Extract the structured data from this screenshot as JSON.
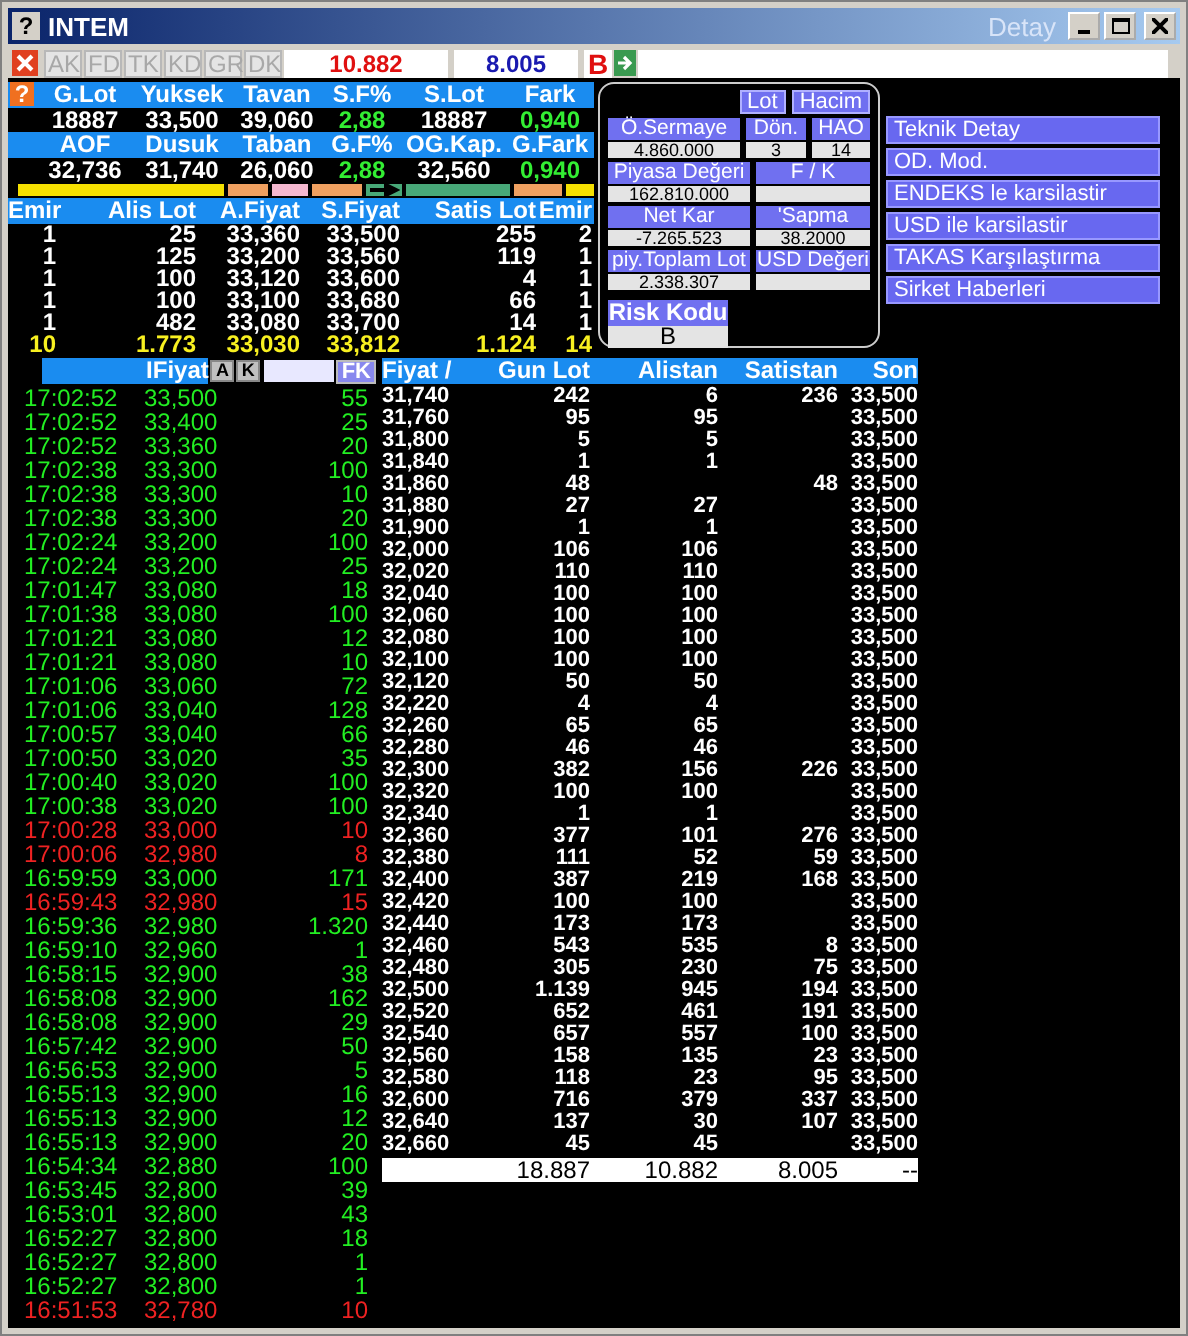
{
  "window": {
    "title": "INTEM",
    "help_icon": "?",
    "subtitle": "Detay"
  },
  "toolbar": {
    "tabs": [
      {
        "label": "AK",
        "disabled": true
      },
      {
        "label": "FD",
        "disabled": true
      },
      {
        "label": "TK",
        "disabled": true
      },
      {
        "label": "KD",
        "disabled": true
      },
      {
        "label": "GR",
        "disabled": true
      },
      {
        "label": "DK",
        "disabled": true
      }
    ],
    "buy_total": "10.882",
    "sell_total": "8.005",
    "side": "B"
  },
  "stats": {
    "help_icon": "?",
    "rows": [
      [
        {
          "label": "G.Lot",
          "value": "18887",
          "kind": "plain"
        },
        {
          "label": "Yuksek",
          "value": "33,500",
          "kind": "plain"
        },
        {
          "label": "Tavan",
          "value": "39,060",
          "kind": "plain"
        },
        {
          "label": "S.F%",
          "value": "2,88",
          "kind": "change"
        },
        {
          "label": "S.Lot",
          "value": "18887",
          "kind": "plain"
        },
        {
          "label": "Fark",
          "value": "0,940",
          "kind": "change"
        }
      ],
      [
        {
          "label": "AOF",
          "value": "32,736",
          "kind": "plain"
        },
        {
          "label": "Dusuk",
          "value": "31,740",
          "kind": "plain"
        },
        {
          "label": "Taban",
          "value": "26,060",
          "kind": "plain"
        },
        {
          "label": "G.F%",
          "value": "2,88",
          "kind": "change"
        },
        {
          "label": "OG.Kap.",
          "value": "32,560",
          "kind": "plain"
        },
        {
          "label": "G.Fark",
          "value": "0,940",
          "kind": "change"
        }
      ]
    ]
  },
  "bar": [
    {
      "kind": "segment",
      "color": "#f5e000"
    },
    {
      "kind": "segment",
      "color": "#f0a060"
    },
    {
      "kind": "segment",
      "color": "#f4b8d0"
    },
    {
      "kind": "segment",
      "color": "#f0a060"
    },
    {
      "kind": "arrow",
      "color": "#48a878"
    },
    {
      "kind": "segment",
      "color": "#48a878"
    },
    {
      "kind": "segment",
      "color": "#f0a060"
    },
    {
      "kind": "segment",
      "color": "#f5e000"
    }
  ],
  "orderbook": {
    "columns": [
      "Emir",
      "Alis Lot",
      "A.Fiyat",
      "S.Fiyat",
      "Satis Lot",
      "Emir"
    ],
    "rows": [
      {
        "kind": "level",
        "cells": [
          "1",
          "25",
          "33,360",
          "33,500",
          "255",
          "2"
        ]
      },
      {
        "kind": "level",
        "cells": [
          "1",
          "125",
          "33,200",
          "33,560",
          "119",
          "1"
        ]
      },
      {
        "kind": "level",
        "cells": [
          "1",
          "100",
          "33,120",
          "33,600",
          "4",
          "1"
        ]
      },
      {
        "kind": "level",
        "cells": [
          "1",
          "100",
          "33,100",
          "33,680",
          "66",
          "1"
        ]
      },
      {
        "kind": "level",
        "cells": [
          "1",
          "482",
          "33,080",
          "33,700",
          "14",
          "1"
        ]
      },
      {
        "kind": "total",
        "cells": [
          "10",
          "1.773",
          "33,030",
          "33,812",
          "1.124",
          "14"
        ]
      }
    ]
  },
  "panel": {
    "buttons": [
      "Lot",
      "Hacim"
    ],
    "rows": [
      [
        {
          "label": "Ö.Sermaye",
          "value": "4.860.000"
        },
        {
          "label": "Dön.",
          "value": "3"
        },
        {
          "label": "HAO",
          "value": "14"
        }
      ],
      [
        {
          "label": "Piyasa Değeri",
          "value": "162.810.000"
        },
        {
          "label": "F / K"
        }
      ],
      [
        {
          "label": "Net Kar",
          "value": "-7.265.523"
        },
        {
          "label": "'Sapma",
          "value": "38.2000"
        }
      ],
      [
        {
          "label": "piy.Toplam Lot",
          "value": "2.338.307"
        },
        {
          "label": "USD Değeri"
        }
      ]
    ],
    "risk": {
      "label": "Risk Kodu",
      "value": "B"
    }
  },
  "menu": [
    "Teknik Detay",
    "OD. Mod.",
    "ENDEKS le karsilastir",
    "USD ile karsilastir",
    "TAKAS Karşılaştırma",
    "Sirket Haberleri"
  ],
  "trades": {
    "header": "IFiyat",
    "buttons": [
      "A",
      "K"
    ],
    "filter_button": "FK",
    "rows": [
      {
        "time": "17:02:52",
        "price": "33,500",
        "lot": "55",
        "color": "#22ee22"
      },
      {
        "time": "17:02:52",
        "price": "33,400",
        "lot": "25",
        "color": "#22ee22"
      },
      {
        "time": "17:02:52",
        "price": "33,360",
        "lot": "20",
        "color": "#22ee22"
      },
      {
        "time": "17:02:38",
        "price": "33,300",
        "lot": "100",
        "color": "#22ee22"
      },
      {
        "time": "17:02:38",
        "price": "33,300",
        "lot": "10",
        "color": "#22ee22"
      },
      {
        "time": "17:02:38",
        "price": "33,300",
        "lot": "20",
        "color": "#22ee22"
      },
      {
        "time": "17:02:24",
        "price": "33,200",
        "lot": "100",
        "color": "#22ee22"
      },
      {
        "time": "17:02:24",
        "price": "33,200",
        "lot": "25",
        "color": "#22ee22"
      },
      {
        "time": "17:01:47",
        "price": "33,080",
        "lot": "18",
        "color": "#22ee22"
      },
      {
        "time": "17:01:38",
        "price": "33,080",
        "lot": "100",
        "color": "#22ee22"
      },
      {
        "time": "17:01:21",
        "price": "33,080",
        "lot": "12",
        "color": "#22ee22"
      },
      {
        "time": "17:01:21",
        "price": "33,080",
        "lot": "10",
        "color": "#22ee22"
      },
      {
        "time": "17:01:06",
        "price": "33,060",
        "lot": "72",
        "color": "#22ee22"
      },
      {
        "time": "17:01:06",
        "price": "33,040",
        "lot": "128",
        "color": "#22ee22"
      },
      {
        "time": "17:00:57",
        "price": "33,040",
        "lot": "66",
        "color": "#22ee22"
      },
      {
        "time": "17:00:50",
        "price": "33,020",
        "lot": "35",
        "color": "#22ee22"
      },
      {
        "time": "17:00:40",
        "price": "33,020",
        "lot": "100",
        "color": "#22ee22"
      },
      {
        "time": "17:00:38",
        "price": "33,020",
        "lot": "100",
        "color": "#22ee22"
      },
      {
        "time": "17:00:28",
        "price": "33,000",
        "lot": "10",
        "color": "#ee2222"
      },
      {
        "time": "17:00:06",
        "price": "32,980",
        "lot": "8",
        "color": "#ee2222"
      },
      {
        "time": "16:59:59",
        "price": "33,000",
        "lot": "171",
        "color": "#22ee22"
      },
      {
        "time": "16:59:43",
        "price": "32,980",
        "lot": "15",
        "color": "#ee2222"
      },
      {
        "time": "16:59:36",
        "price": "32,980",
        "lot": "1.320",
        "color": "#22ee22"
      },
      {
        "time": "16:59:10",
        "price": "32,960",
        "lot": "1",
        "color": "#22ee22"
      },
      {
        "time": "16:58:15",
        "price": "32,900",
        "lot": "38",
        "color": "#22ee22"
      },
      {
        "time": "16:58:08",
        "price": "32,900",
        "lot": "162",
        "color": "#22ee22"
      },
      {
        "time": "16:58:08",
        "price": "32,900",
        "lot": "29",
        "color": "#22ee22"
      },
      {
        "time": "16:57:42",
        "price": "32,900",
        "lot": "50",
        "color": "#22ee22"
      },
      {
        "time": "16:56:53",
        "price": "32,900",
        "lot": "5",
        "color": "#22ee22"
      },
      {
        "time": "16:55:13",
        "price": "32,900",
        "lot": "16",
        "color": "#22ee22"
      },
      {
        "time": "16:55:13",
        "price": "32,900",
        "lot": "12",
        "color": "#22ee22"
      },
      {
        "time": "16:55:13",
        "price": "32,900",
        "lot": "20",
        "color": "#22ee22"
      },
      {
        "time": "16:54:34",
        "price": "32,880",
        "lot": "100",
        "color": "#22ee22"
      },
      {
        "time": "16:53:45",
        "price": "32,800",
        "lot": "39",
        "color": "#22ee22"
      },
      {
        "time": "16:53:01",
        "price": "32,800",
        "lot": "43",
        "color": "#22ee22"
      },
      {
        "time": "16:52:27",
        "price": "32,800",
        "lot": "18",
        "color": "#22ee22"
      },
      {
        "time": "16:52:27",
        "price": "32,800",
        "lot": "1",
        "color": "#22ee22"
      },
      {
        "time": "16:52:27",
        "price": "32,800",
        "lot": "1",
        "color": "#22ee22"
      },
      {
        "time": "16:51:53",
        "price": "32,780",
        "lot": "10",
        "color": "#ee2222"
      }
    ]
  },
  "table": {
    "columns": [
      "Fiyat /",
      "Gun Lot",
      "Alistan",
      "Satistan",
      "Son"
    ],
    "rows": [
      {
        "fiyat": "31,740",
        "gun_lot": "242",
        "alistan": "6",
        "satistan": "236",
        "son": "33,500"
      },
      {
        "fiyat": "31,760",
        "gun_lot": "95",
        "alistan": "95",
        "son": "33,500"
      },
      {
        "fiyat": "31,800",
        "gun_lot": "5",
        "alistan": "5",
        "son": "33,500"
      },
      {
        "fiyat": "31,840",
        "gun_lot": "1",
        "alistan": "1",
        "son": "33,500"
      },
      {
        "fiyat": "31,860",
        "gun_lot": "48",
        "satistan": "48",
        "son": "33,500"
      },
      {
        "fiyat": "31,880",
        "gun_lot": "27",
        "alistan": "27",
        "son": "33,500"
      },
      {
        "fiyat": "31,900",
        "gun_lot": "1",
        "alistan": "1",
        "son": "33,500"
      },
      {
        "fiyat": "32,000",
        "gun_lot": "106",
        "alistan": "106",
        "son": "33,500"
      },
      {
        "fiyat": "32,020",
        "gun_lot": "110",
        "alistan": "110",
        "son": "33,500"
      },
      {
        "fiyat": "32,040",
        "gun_lot": "100",
        "alistan": "100",
        "son": "33,500"
      },
      {
        "fiyat": "32,060",
        "gun_lot": "100",
        "alistan": "100",
        "son": "33,500"
      },
      {
        "fiyat": "32,080",
        "gun_lot": "100",
        "alistan": "100",
        "son": "33,500"
      },
      {
        "fiyat": "32,100",
        "gun_lot": "100",
        "alistan": "100",
        "son": "33,500"
      },
      {
        "fiyat": "32,120",
        "gun_lot": "50",
        "alistan": "50",
        "son": "33,500"
      },
      {
        "fiyat": "32,220",
        "gun_lot": "4",
        "alistan": "4",
        "son": "33,500"
      },
      {
        "fiyat": "32,260",
        "gun_lot": "65",
        "alistan": "65",
        "son": "33,500"
      },
      {
        "fiyat": "32,280",
        "gun_lot": "46",
        "alistan": "46",
        "son": "33,500"
      },
      {
        "fiyat": "32,300",
        "gun_lot": "382",
        "alistan": "156",
        "satistan": "226",
        "son": "33,500"
      },
      {
        "fiyat": "32,320",
        "gun_lot": "100",
        "alistan": "100",
        "son": "33,500"
      },
      {
        "fiyat": "32,340",
        "gun_lot": "1",
        "alistan": "1",
        "son": "33,500"
      },
      {
        "fiyat": "32,360",
        "gun_lot": "377",
        "alistan": "101",
        "satistan": "276",
        "son": "33,500"
      },
      {
        "fiyat": "32,380",
        "gun_lot": "111",
        "alistan": "52",
        "satistan": "59",
        "son": "33,500"
      },
      {
        "fiyat": "32,400",
        "gun_lot": "387",
        "alistan": "219",
        "satistan": "168",
        "son": "33,500"
      },
      {
        "fiyat": "32,420",
        "gun_lot": "100",
        "alistan": "100",
        "son": "33,500"
      },
      {
        "fiyat": "32,440",
        "gun_lot": "173",
        "alistan": "173",
        "son": "33,500"
      },
      {
        "fiyat": "32,460",
        "gun_lot": "543",
        "alistan": "535",
        "satistan": "8",
        "son": "33,500"
      },
      {
        "fiyat": "32,480",
        "gun_lot": "305",
        "alistan": "230",
        "satistan": "75",
        "son": "33,500"
      },
      {
        "fiyat": "32,500",
        "gun_lot": "1.139",
        "alistan": "945",
        "satistan": "194",
        "son": "33,500"
      },
      {
        "fiyat": "32,520",
        "gun_lot": "652",
        "alistan": "461",
        "satistan": "191",
        "son": "33,500"
      },
      {
        "fiyat": "32,540",
        "gun_lot": "657",
        "alistan": "557",
        "satistan": "100",
        "son": "33,500"
      },
      {
        "fiyat": "32,560",
        "gun_lot": "158",
        "alistan": "135",
        "satistan": "23",
        "son": "33,500"
      },
      {
        "fiyat": "32,580",
        "gun_lot": "118",
        "alistan": "23",
        "satistan": "95",
        "son": "33,500"
      },
      {
        "fiyat": "32,600",
        "gun_lot": "716",
        "alistan": "379",
        "satistan": "337",
        "son": "33,500"
      },
      {
        "fiyat": "32,640",
        "gun_lot": "137",
        "alistan": "30",
        "satistan": "107",
        "son": "33,500"
      },
      {
        "fiyat": "32,660",
        "gun_lot": "45",
        "alistan": "45",
        "son": "33,500"
      }
    ],
    "totals": [
      "18.887",
      "10.882",
      "8.005",
      "--"
    ]
  }
}
